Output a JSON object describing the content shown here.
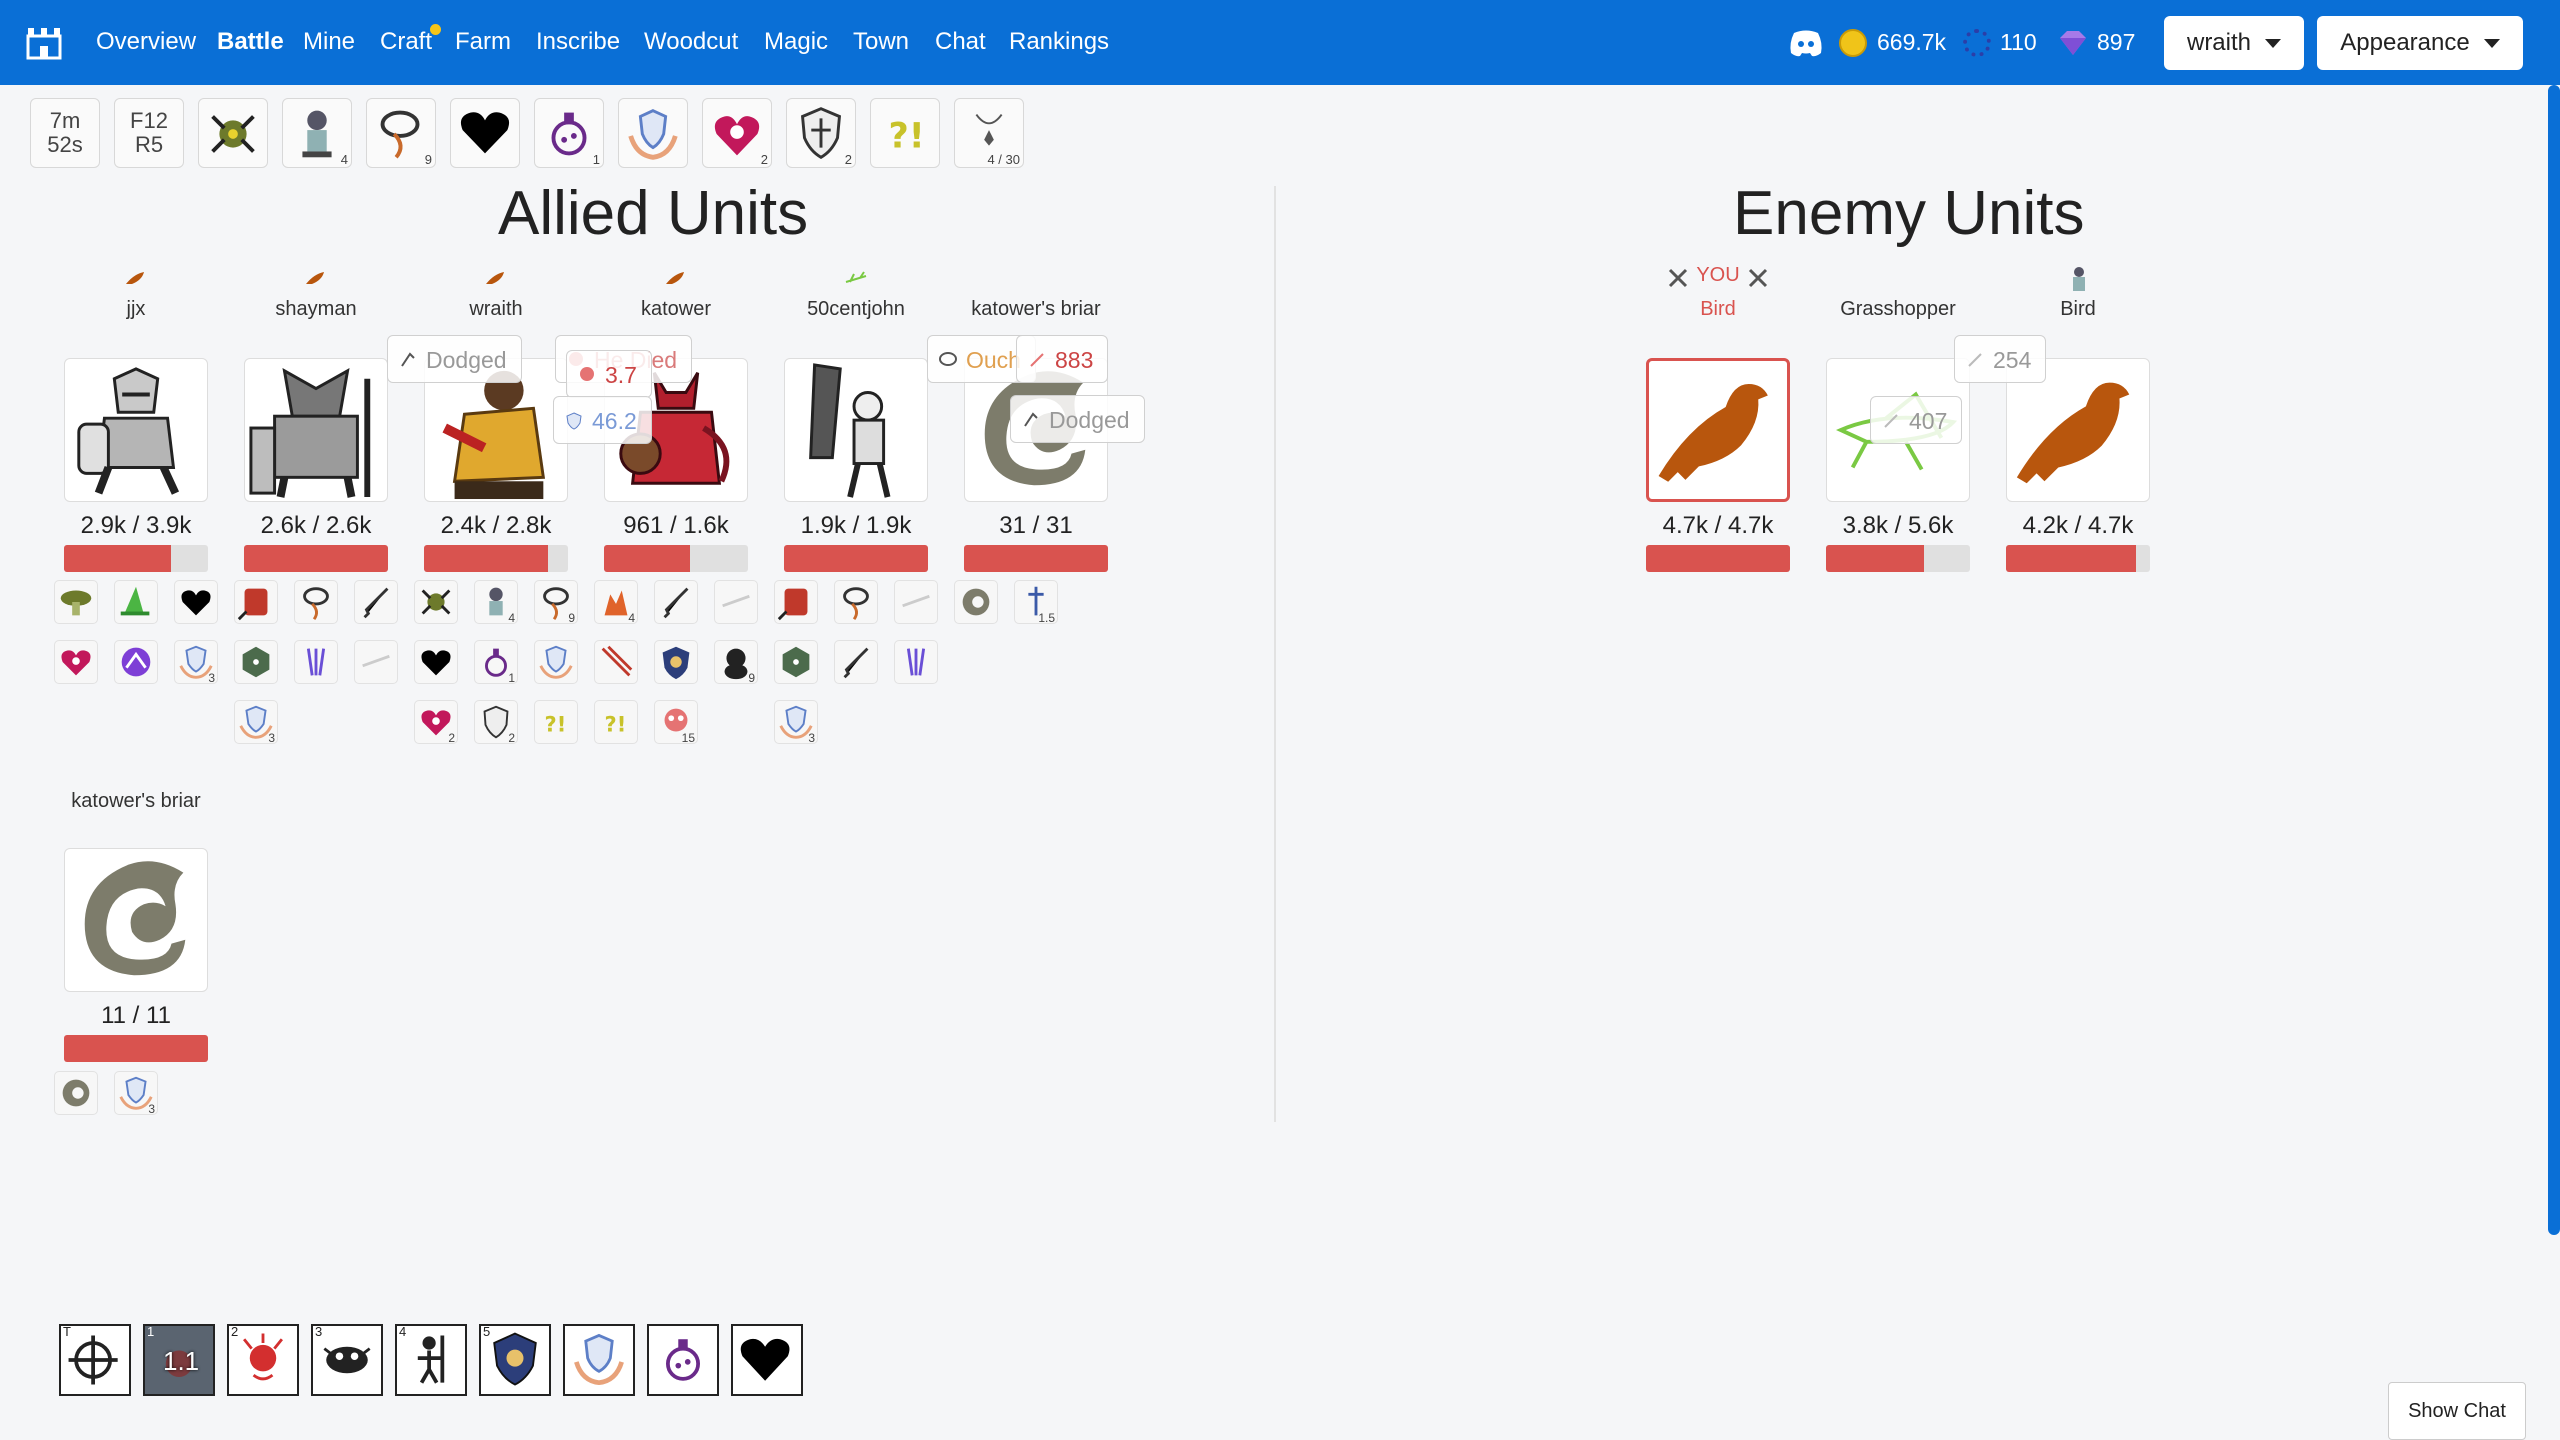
{
  "nav": {
    "items": [
      "Overview",
      "Battle",
      "Mine",
      "Craft",
      "Farm",
      "Inscribe",
      "Woodcut",
      "Magic",
      "Town",
      "Chat",
      "Rankings"
    ],
    "active": "Battle",
    "currency": {
      "gold": "669.7k",
      "orbs": "110",
      "gems": "897"
    },
    "user_button": "wraith",
    "appearance_button": "Appearance"
  },
  "strip": {
    "timer": [
      "7m",
      "52s"
    ],
    "floor": [
      "F12",
      "R5"
    ],
    "badges": [
      "",
      "4",
      "9",
      "",
      "1",
      "",
      "2",
      "2",
      "",
      "4 / 30"
    ]
  },
  "headings": {
    "allied": "Allied Units",
    "enemy": "Enemy Units"
  },
  "allies": [
    {
      "name": "jjx",
      "hp": "2.9k / 3.9k",
      "hp_fraction": 0.74
    },
    {
      "name": "shayman",
      "hp": "2.6k / 2.6k",
      "hp_fraction": 1.0
    },
    {
      "name": "wraith",
      "hp": "2.4k / 2.8k",
      "hp_fraction": 0.86
    },
    {
      "name": "katower",
      "hp": "961 / 1.6k",
      "hp_fraction": 0.6
    },
    {
      "name": "50centjohn",
      "hp": "1.9k / 1.9k",
      "hp_fraction": 1.0
    },
    {
      "name": "katower's briar",
      "hp": "31 / 31",
      "hp_fraction": 1.0
    }
  ],
  "summon": {
    "name": "katower's briar",
    "hp": "11 / 11",
    "hp_fraction": 1.0
  },
  "enemies": [
    {
      "label": "YOU",
      "name": "Bird",
      "hp": "4.7k / 4.7k",
      "hp_fraction": 1.0
    },
    {
      "label": "",
      "name": "Grasshopper",
      "hp": "3.8k / 5.6k",
      "hp_fraction": 0.68
    },
    {
      "label": "",
      "name": "Bird",
      "hp": "4.2k / 4.7k",
      "hp_fraction": 0.9
    }
  ],
  "floats": {
    "dodged1": "Dodged",
    "died": "He Died",
    "dmg1": "3.7",
    "shield1": "46.2",
    "ouch": "Ouch",
    "dmg2": "883",
    "dodged2": "Dodged",
    "dmg3": "254",
    "dmg4": "407",
    "faded": "1.5"
  },
  "chip_subs": {
    "jjx": [
      "",
      "",
      "",
      "",
      "",
      ""
    ],
    "row2": [
      "4",
      "9",
      "",
      "4",
      "",
      ""
    ],
    "counts": [
      "3",
      "1",
      "9",
      "3",
      "2",
      "2",
      "15",
      "3",
      "3",
      "1.5"
    ]
  },
  "hotbar": {
    "keys": [
      "T",
      "1",
      "2",
      "3",
      "4",
      "5"
    ],
    "active_value": "1.1"
  },
  "show_chat": "Show Chat",
  "colors": {
    "nav": "#0a6fd6",
    "hp": "#d9534f",
    "enemy_label": "#d9534f"
  }
}
